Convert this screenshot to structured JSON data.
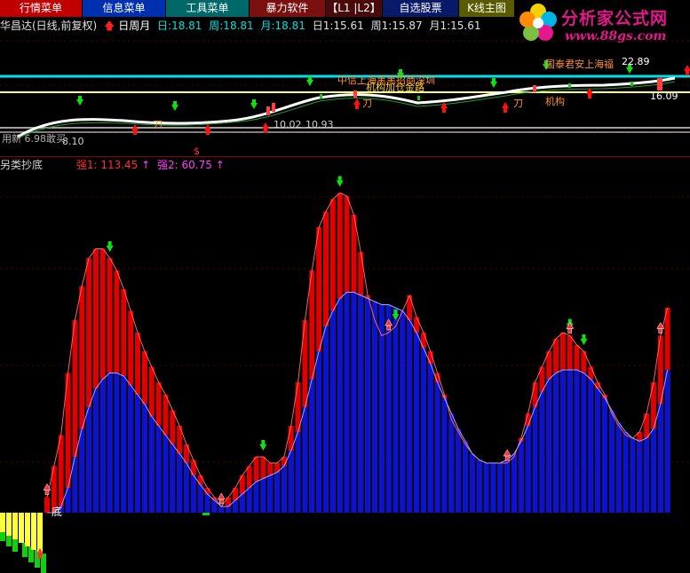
{
  "menu": [
    {
      "label": "行情菜单",
      "bg": "#c00000"
    },
    {
      "label": "信息菜单",
      "bg": "#0030b0"
    },
    {
      "label": "工具菜单",
      "bg": "#006868"
    },
    {
      "label": "暴力软件",
      "bg": "#7a1010"
    },
    {
      "label": "【L1 |L2】",
      "bg": "#4a0a0a"
    },
    {
      "label": "自选股票",
      "bg": "#0a1a6a"
    },
    {
      "label": "K线主图",
      "bg": "#5a5a00"
    }
  ],
  "logo": {
    "title": "分析家公式网",
    "url": "www.88gs.com",
    "colors": {
      "pink": "#e4178c",
      "yellow": "#f5d000",
      "cyan": "#00b4e6"
    }
  },
  "info": {
    "stock": "华昌达(日线,前复权)",
    "period_label": "日周月",
    "ri": "日:18.81",
    "zhou": "周:18.81",
    "yue": "月:18.81",
    "ri1": "日1:15.61",
    "zhou1": "周1:15.87",
    "yue1": "月1:15.61",
    "colors": {
      "stock": "#e0e0e0",
      "period": "#ffffff",
      "values": "#00e0e0",
      "values1": "#e0e0e0"
    }
  },
  "upper_labels": {
    "zhongxin": "中信上海黑黑招商深圳",
    "jiqi": "机构加仓金路",
    "guotai": "国泰君安上海福",
    "price_2289": "22.89",
    "price_1609": "16.09",
    "dao1": "刀",
    "dao2": "刀",
    "dao3": "刀",
    "jigou": "机构",
    "price_1002": "10.02",
    "price_1093": "10.93",
    "price_810": "8.10",
    "yongxin": "用新",
    "bottom_left": "用新 6.98敢买"
  },
  "indicator": {
    "name": "另类抄底",
    "qiang1": "强1: 113.45",
    "qiang2": "强2: 60.75",
    "bottom_label": "底",
    "colors": {
      "name": "#d0d0d0",
      "qiang1": "#ff3030",
      "qiang2": "#ff40ff",
      "red": "#e00000",
      "blue": "#0a14d0",
      "yellow": "#ffff40",
      "green": "#10d010",
      "cyan": "#00e0ff"
    }
  },
  "chart_data": {
    "type": "bar",
    "title": "另类抄底",
    "series": [
      {
        "name": "强1",
        "values": [
          5,
          15,
          25,
          45,
          62,
          73,
          82,
          85,
          85,
          82,
          78,
          72,
          65,
          58,
          52,
          47,
          42,
          38,
          33,
          28,
          22,
          17,
          12,
          8,
          5,
          2,
          5,
          8,
          12,
          15,
          18,
          18,
          16,
          16,
          18,
          28,
          42,
          62,
          78,
          92,
          97,
          101,
          103,
          102,
          96,
          84,
          70,
          62,
          57,
          58,
          60,
          65,
          70,
          63,
          58,
          52,
          45,
          38,
          30,
          26,
          22,
          19,
          17,
          16,
          16,
          16,
          16,
          18,
          24,
          32,
          42,
          47,
          52,
          56,
          58,
          57,
          54,
          52,
          47,
          42,
          38,
          32,
          28,
          25,
          24,
          26,
          32,
          42,
          57,
          66
        ]
      },
      {
        "name": "强2",
        "values": [
          0,
          0,
          2,
          8,
          18,
          27,
          34,
          40,
          43,
          45,
          45,
          44,
          41,
          38,
          35,
          31,
          28,
          25,
          22,
          19,
          16,
          12,
          9,
          6,
          4,
          2,
          2,
          4,
          6,
          8,
          10,
          11,
          12,
          13,
          15,
          20,
          26,
          34,
          43,
          52,
          60,
          65,
          69,
          71,
          71,
          70,
          69,
          68,
          67,
          67,
          66,
          65,
          62,
          58,
          53,
          48,
          42,
          37,
          32,
          27,
          23,
          19,
          17,
          16,
          16,
          16,
          17,
          19,
          23,
          28,
          34,
          39,
          43,
          45,
          46,
          46,
          46,
          45,
          43,
          40,
          37,
          33,
          29,
          26,
          24,
          23,
          24,
          27,
          35,
          46
        ]
      }
    ]
  }
}
